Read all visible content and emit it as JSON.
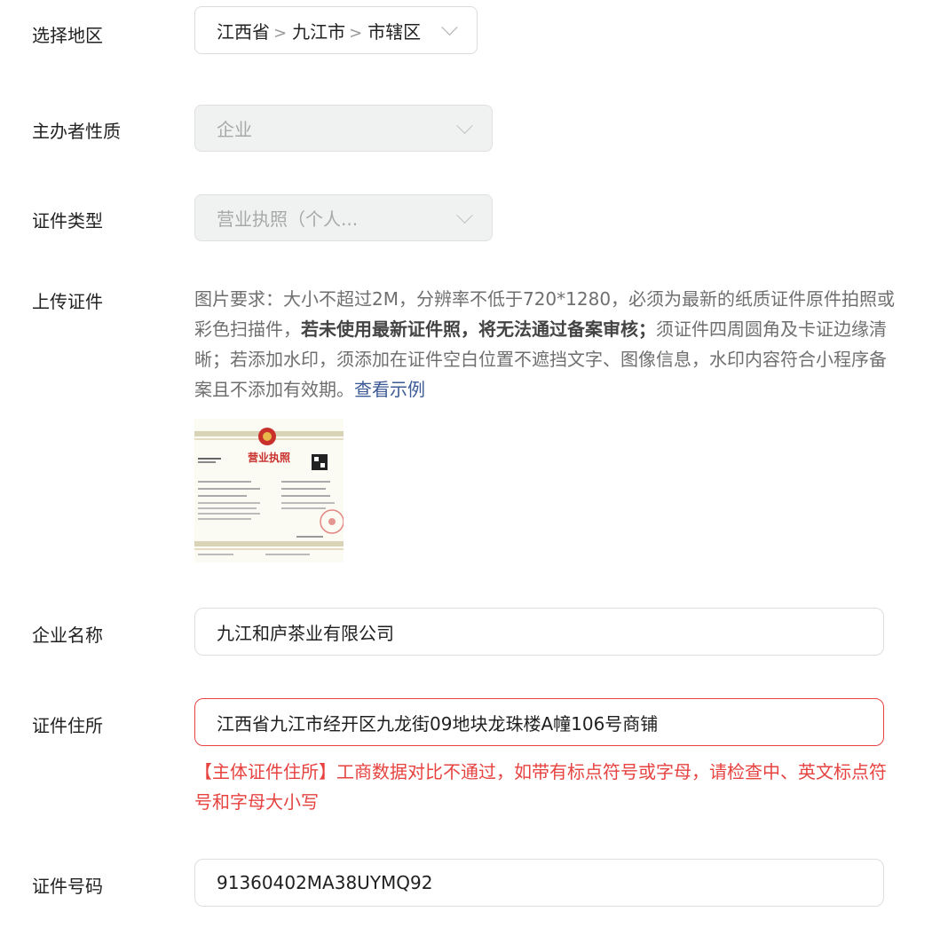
{
  "region": {
    "label": "选择地区",
    "province": "江西省",
    "city": "九江市",
    "district": "市辖区",
    "separator": ">"
  },
  "sponsor_type": {
    "label": "主办者性质",
    "value": "企业"
  },
  "cert_type": {
    "label": "证件类型",
    "value": "营业执照（个人..."
  },
  "upload": {
    "label": "上传证件",
    "desc_part1": "图片要求：大小不超过2M，分辨率不低于720*1280，必须为最新的纸质证件原件拍照或彩色扫描件，",
    "desc_bold": "若未使用最新证件照，将无法通过备案审核；",
    "desc_part2": "须证件四周圆角及卡证边缘清晰；若添加水印，须添加在证件空白位置不遮挡文字、图像信息，水印内容符合小程序备案且不添加有效期。",
    "example_link": "查看示例",
    "thumb_title": "营业执照"
  },
  "company_name": {
    "label": "企业名称",
    "value": "九江和庐茶业有限公司"
  },
  "cert_address": {
    "label": "证件住所",
    "value": "江西省九江市经开区九龙街09地块龙珠楼A幢106号商铺",
    "error": "【主体证件住所】工商数据对比不通过，如带有标点符号或字母，请检查中、英文标点符号和字母大小写"
  },
  "cert_number": {
    "label": "证件号码",
    "value": "91360402MA38UYMQ92"
  },
  "colors": {
    "error": "#e64340",
    "link": "#3c5a96",
    "disabled_bg": "#f0f2f2"
  }
}
